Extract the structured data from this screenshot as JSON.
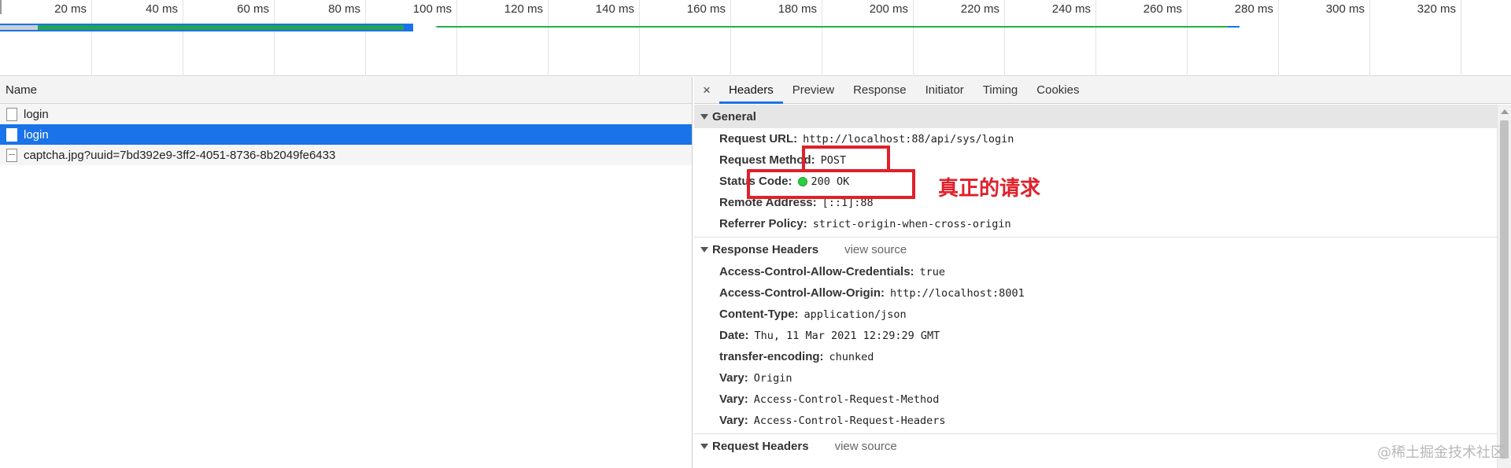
{
  "timeline": {
    "ticks": [
      "20 ms",
      "40 ms",
      "60 ms",
      "80 ms",
      "100 ms",
      "120 ms",
      "140 ms",
      "160 ms",
      "180 ms",
      "200 ms",
      "220 ms",
      "240 ms",
      "260 ms",
      "280 ms",
      "300 ms",
      "320 ms"
    ],
    "colors": {
      "blue": "#1a73e8",
      "green": "#23a455"
    }
  },
  "request_list": {
    "header": "Name",
    "rows": [
      {
        "name": "login",
        "icon": "document-icon",
        "selected": false
      },
      {
        "name": "login",
        "icon": "document-icon",
        "selected": true
      },
      {
        "name": "captcha.jpg?uuid=7bd392e9-3ff2-4051-8736-8b2049fe6433",
        "icon": "image-icon",
        "selected": false
      }
    ]
  },
  "details": {
    "close_glyph": "×",
    "tabs": [
      "Headers",
      "Preview",
      "Response",
      "Initiator",
      "Timing",
      "Cookies"
    ],
    "active_tab": "Headers",
    "general": {
      "title": "General",
      "request_url_key": "Request URL:",
      "request_url": "http://localhost:88/api/sys/login",
      "request_method_key": "Request Method:",
      "request_method": "POST",
      "status_code_key": "Status Code:",
      "status_code": "200 OK",
      "status_color": "#2ecc40",
      "remote_address_key": "Remote Address:",
      "remote_address": "[::1]:88",
      "referrer_policy_key": "Referrer Policy:",
      "referrer_policy": "strict-origin-when-cross-origin"
    },
    "response_headers": {
      "title": "Response Headers",
      "view_source": "view source",
      "items": [
        {
          "key": "Access-Control-Allow-Credentials:",
          "value": "true"
        },
        {
          "key": "Access-Control-Allow-Origin:",
          "value": "http://localhost:8001"
        },
        {
          "key": "Content-Type:",
          "value": "application/json"
        },
        {
          "key": "Date:",
          "value": "Thu, 11 Mar 2021 12:29:29 GMT"
        },
        {
          "key": "transfer-encoding:",
          "value": "chunked"
        },
        {
          "key": "Vary:",
          "value": "Origin"
        },
        {
          "key": "Vary:",
          "value": "Access-Control-Request-Method"
        },
        {
          "key": "Vary:",
          "value": "Access-Control-Request-Headers"
        }
      ]
    },
    "request_headers": {
      "title": "Request Headers",
      "view_source": "view source"
    }
  },
  "annotation": {
    "text": "真正的请求",
    "color": "#e0202a"
  },
  "watermark": "@稀土掘金技术社区"
}
